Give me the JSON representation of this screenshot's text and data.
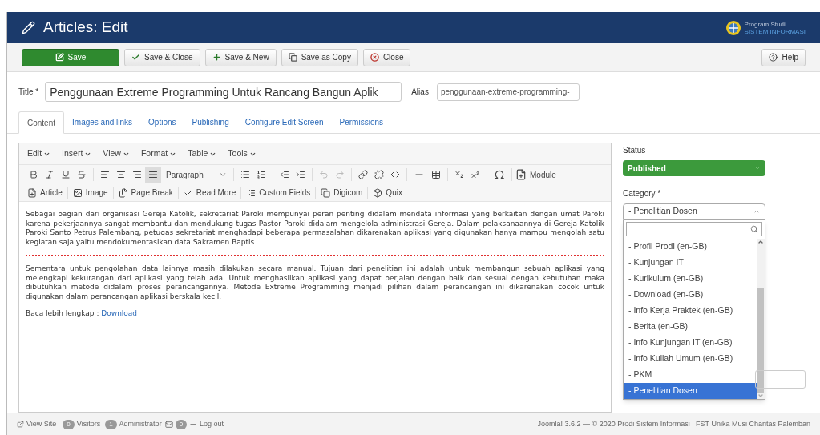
{
  "header": {
    "title": "Articles: Edit",
    "logo_line_1": "Program Studi",
    "logo_line_2": "SISTEM INFORMASI"
  },
  "toolbar": [
    {
      "kind": "save",
      "label": "Save"
    },
    {
      "kind": "check",
      "label": "Save & Close"
    },
    {
      "kind": "plus",
      "label": "Save & New"
    },
    {
      "kind": "copy",
      "label": "Save as Copy"
    },
    {
      "kind": "close",
      "label": "Close"
    }
  ],
  "help": "Help",
  "title_field": {
    "label": "Title *",
    "value": "Penggunaan Extreme Programming Untuk Rancang Bangun Aplik"
  },
  "alias_field": {
    "label": "Alias",
    "value": "penggunaan-extreme-programming-"
  },
  "tabs": [
    {
      "label": "Content",
      "selected": true
    },
    {
      "label": "Images and links",
      "selected": false
    },
    {
      "label": "Options",
      "selected": false
    },
    {
      "label": "Publishing",
      "selected": false
    },
    {
      "label": "Configure Edit Screen",
      "selected": false
    },
    {
      "label": "Permissions",
      "selected": false
    }
  ],
  "editor": {
    "menus": [
      "Edit",
      "Insert",
      "View",
      "Format",
      "Table",
      "Tools"
    ],
    "alignment": [
      {
        "kind": "left",
        "selected": false
      },
      {
        "kind": "center",
        "selected": false
      },
      {
        "kind": "right",
        "selected": false
      },
      {
        "kind": "justify",
        "selected": true
      }
    ],
    "block_format": "Paragraph",
    "module": "Module",
    "buttons": [
      {
        "kind": "article",
        "label": "Article"
      },
      {
        "kind": "image",
        "label": "Image"
      },
      {
        "kind": "pagebreak",
        "label": "Page Break"
      },
      {
        "kind": "readmore",
        "label": "Read More"
      },
      {
        "kind": "fields",
        "label": "Custom Fields"
      },
      {
        "kind": "copy",
        "label": "Digicom"
      },
      {
        "kind": "box",
        "label": "Quix"
      }
    ],
    "paragraph_1": "Sebagai bagian dari organisasi Gereja Katolik, sekretariat Paroki mempunyai peran penting didalam mendata informasi yang berkaitan dengan umat Paroki karena pekerjaannya sangat membantu dan mendukung tugas Pastor Paroki didalam mengelola administrasi Gereja. Dalam pelaksanaannya di Gereja Katolik Paroki Santo Petrus Palembang, petugas sekretariat menghadapi beberapa permasalahan dikarenakan aplikasi yang digunakan hanya mampu mengolah satu kegiatan saja yaitu mendokumentasikan data Sakramen Baptis.",
    "paragraph_2": "Sementara untuk pengolahan data lainnya masih dilakukan secara manual. Tujuan dari penelitian ini adalah untuk membangun sebuah aplikasi yang melengkapi kekurangan dari aplikasi yang telah ada. Untuk menghasilkan aplikasi yang dapat berjalan dengan baik dan sesuai dengan kebutuhan maka dibutuhkan metode didalam proses perancangannya. Metode Extreme Programming menjadi pilihan dalam perancangan ini dikarenakan cocok untuk digunakan dalam perancangan aplikasi berskala kecil.",
    "read_more_text": "Baca lebih lengkap : ",
    "read_more_link": "Download"
  },
  "sidebar": {
    "status_label": "Status",
    "status": "Published",
    "category_label": "Category *",
    "category": "- Penelitian Dosen",
    "options": [
      {
        "label": "- Profil Prodi (en-GB)",
        "selected": false
      },
      {
        "label": "- Kunjungan IT",
        "selected": false
      },
      {
        "label": "- Kurikulum (en-GB)",
        "selected": false
      },
      {
        "label": "- Download (en-GB)",
        "selected": false
      },
      {
        "label": "- Info Kerja Praktek (en-GB)",
        "selected": false
      },
      {
        "label": "- Berita (en-GB)",
        "selected": false
      },
      {
        "label": "- Info Kunjungan IT (en-GB)",
        "selected": false
      },
      {
        "label": "- Info Kuliah Umum (en-GB)",
        "selected": false
      },
      {
        "label": "- PKM",
        "selected": false
      },
      {
        "label": "- Penelitian Dosen",
        "selected": true
      }
    ]
  },
  "status_bar": {
    "view_site": "View Site",
    "visitors_count": "0",
    "visitors": "Visitors",
    "admin_count": "1",
    "admin": "Administrator",
    "messages_count": "0",
    "logout": "Log out",
    "copyright": "Joomla! 3.6.2 — © 2020 Prodi Sistem Informasi | FST Unika Musi Charitas Palemban"
  }
}
